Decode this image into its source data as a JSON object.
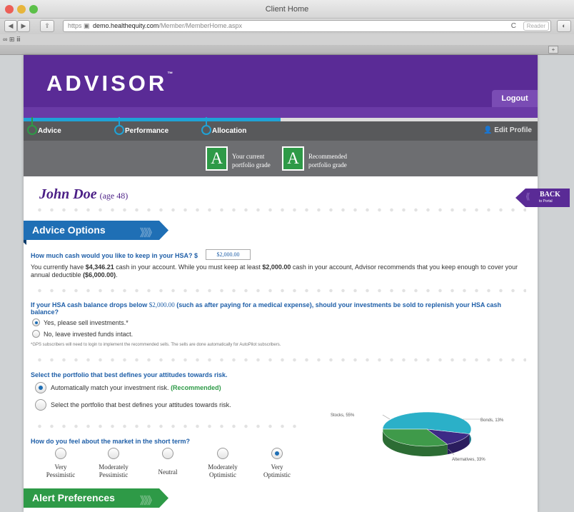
{
  "browser": {
    "window_title": "Client Home",
    "url_scheme": "https",
    "url_host": "demo.healthequity.com",
    "url_path": "/Member/MemberHome.aspx",
    "reader_label": "Reader",
    "back_glyph": "◀",
    "forward_glyph": "▶",
    "reload_glyph": "C",
    "bookmark_icons": "∞ ⊞ ⅲ",
    "tab_add_glyph": "+"
  },
  "header": {
    "logo_text": "ADVISOR",
    "logo_tm": "™",
    "logout_label": "Logout"
  },
  "nav": {
    "progress_fraction": 0.5,
    "steps": [
      {
        "label": "Advice",
        "color": "#2e9a47"
      },
      {
        "label": "Performance",
        "color": "#1fa2d6"
      },
      {
        "label": "Allocation",
        "color": "#1fa2d6"
      }
    ],
    "edit_profile_label": "Edit Profile",
    "edit_profile_icon": "person-icon"
  },
  "grades": {
    "current_grade": "A",
    "current_label_line1": "Your current",
    "current_label_line2": "portfolio grade",
    "recommended_grade": "A",
    "recommended_label_line1": "Recommended",
    "recommended_label_line2": "portfolio grade"
  },
  "member": {
    "name": "John Doe",
    "age_text": "(age 48)"
  },
  "back": {
    "label": "BACK",
    "sub_label": "to Portal",
    "arrows": "⟪"
  },
  "advice": {
    "section_title": "Advice Options",
    "chevrons": "》》》",
    "cash_question": "How much cash would you like to keep in your HSA? $",
    "cash_value": "$2,000.00",
    "cash_explanation_1": "You currently have ",
    "cash_amount": "$4,346.21",
    "cash_explanation_2": " cash in your account. While you must keep at least ",
    "cash_minimum": "$2,000.00",
    "cash_explanation_3": " cash in your account, Advisor recommends that you keep enough to cover your annual deductible ",
    "cash_deductible": "($6,000.00)",
    "cash_explanation_4": ".",
    "sell_question_a": "If your HSA cash balance drops below ",
    "sell_question_amount": "$2,000.00",
    "sell_question_b": " (such as after paying for a medical expense), should your investments be sold to replenish your HSA cash balance?",
    "sell_yes": "Yes, please sell investments.*",
    "sell_no": "No, leave invested funds intact.",
    "sell_note": "*GPS subscribers will need to login to implement the recommended sells. The sells are done automatically for AutoPilot subscribers.",
    "risk_question": "Select the portfolio that best defines your attitudes towards risk.",
    "risk_auto": "Automatically match your investment risk. ",
    "risk_recommended": "(Recommended)",
    "risk_manual": "Select the portfolio that best defines your attitudes towards risk.",
    "market_question": "How do you feel about the market in the short term?",
    "market_options": [
      {
        "line1": "Very",
        "line2": "Pessimistic",
        "selected": false
      },
      {
        "line1": "Moderately",
        "line2": "Pessimistic",
        "selected": false
      },
      {
        "line1": "Neutral",
        "line2": "",
        "selected": false
      },
      {
        "line1": "Moderately",
        "line2": "Optimistic",
        "selected": false
      },
      {
        "line1": "Very",
        "line2": "Optimistic",
        "selected": true
      }
    ]
  },
  "allocation_pie": {
    "slices": [
      {
        "label": "Stocks, 55%",
        "value": 55,
        "color": "#2bb0c8"
      },
      {
        "label": "Bonds, 13%",
        "value": 13,
        "color": "#3d2a86"
      },
      {
        "label": "Alternatives, 33%",
        "value": 33,
        "color": "#3f9a4a"
      }
    ]
  },
  "alerts": {
    "section_title": "Alert Preferences",
    "chevrons": "》》》"
  }
}
